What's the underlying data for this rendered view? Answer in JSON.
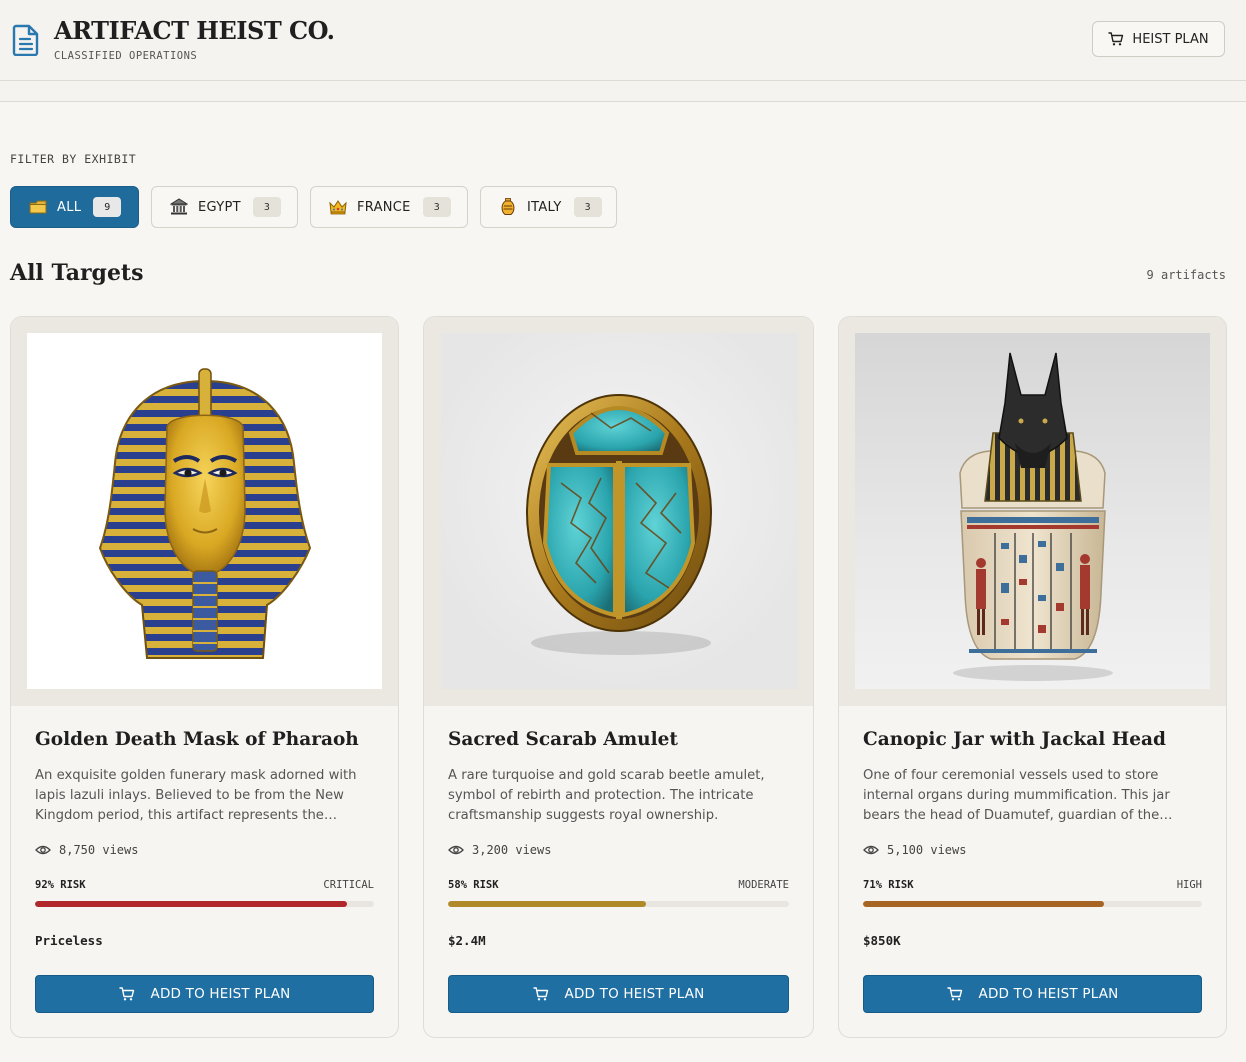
{
  "header": {
    "title": "ARTIFACT HEIST CO.",
    "subtitle": "CLASSIFIED OPERATIONS",
    "plan_button": "HEIST PLAN"
  },
  "filters": {
    "label": "FILTER BY EXHIBIT",
    "items": [
      {
        "label": "ALL",
        "count": "9",
        "active": true,
        "icon": "folder-icon"
      },
      {
        "label": "EGYPT",
        "count": "3",
        "active": false,
        "icon": "museum-icon"
      },
      {
        "label": "FRANCE",
        "count": "3",
        "active": false,
        "icon": "crown-icon"
      },
      {
        "label": "ITALY",
        "count": "3",
        "active": false,
        "icon": "amphora-icon"
      }
    ]
  },
  "section": {
    "title": "All Targets",
    "count": "9 artifacts"
  },
  "cards": [
    {
      "name": "Golden Death Mask of Pharaoh",
      "description": "An exquisite golden funerary mask adorned with lapis lazuli inlays. Believed to be from the New Kingdom period, this artifact represents the…",
      "views": "8,750 views",
      "risk_label": "92% RISK",
      "risk_level": "CRITICAL",
      "risk_value": 92,
      "risk_color": "#b0282c",
      "price": "Priceless",
      "button": "ADD TO HEIST PLAN"
    },
    {
      "name": "Sacred Scarab Amulet",
      "description": "A rare turquoise and gold scarab beetle amulet, symbol of rebirth and protection. The intricate craftsmanship suggests royal ownership.",
      "views": "3,200 views",
      "risk_label": "58% RISK",
      "risk_level": "MODERATE",
      "risk_value": 58,
      "risk_color": "#b08a2a",
      "price": "$2.4M",
      "button": "ADD TO HEIST PLAN"
    },
    {
      "name": "Canopic Jar with Jackal Head",
      "description": "One of four ceremonial vessels used to store internal organs during mummification. This jar bears the head of Duamutef, guardian of the…",
      "views": "5,100 views",
      "risk_label": "71% RISK",
      "risk_level": "HIGH",
      "risk_value": 71,
      "risk_color": "#a86422",
      "price": "$850K",
      "button": "ADD TO HEIST PLAN"
    }
  ]
}
